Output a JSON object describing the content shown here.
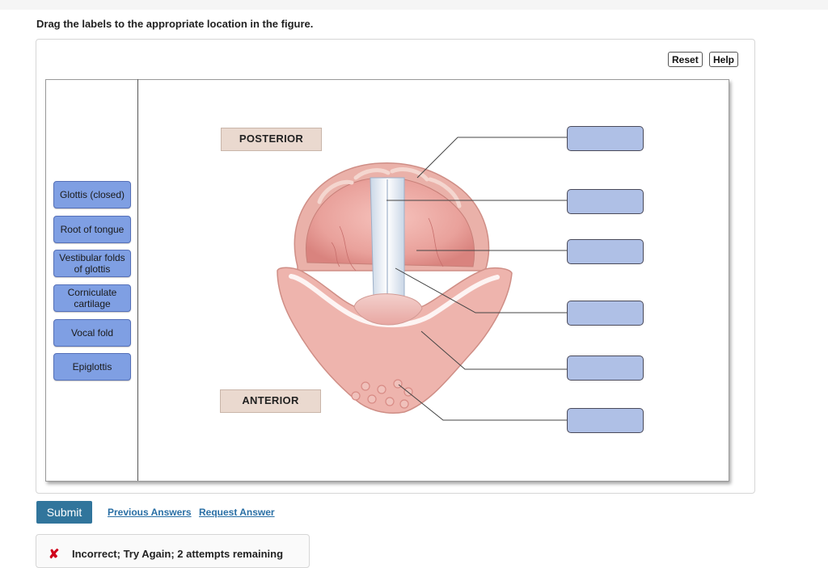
{
  "instructions": "Drag the labels to the appropriate location in the figure.",
  "toolbar": {
    "reset": "Reset",
    "help": "Help"
  },
  "labels": [
    {
      "text": "Glottis (closed)"
    },
    {
      "text": "Root of tongue"
    },
    {
      "text": "Vestibular folds of glottis"
    },
    {
      "text": "Corniculate cartilage"
    },
    {
      "text": "Vocal fold"
    },
    {
      "text": "Epiglottis"
    }
  ],
  "figure": {
    "posterior": "POSTERIOR",
    "anterior": "ANTERIOR"
  },
  "target_count": 6,
  "actions": {
    "submit": "Submit",
    "previous_answers": "Previous Answers",
    "request_answer": "Request Answer"
  },
  "feedback": {
    "icon": "x-icon",
    "text": "Incorrect; Try Again; 2 attempts remaining"
  },
  "colors": {
    "label_fill": "#7f9fe3",
    "target_fill": "#afc0e6",
    "submit_fill": "#31759c",
    "link": "#2a6fa5",
    "error": "#d0021b"
  }
}
